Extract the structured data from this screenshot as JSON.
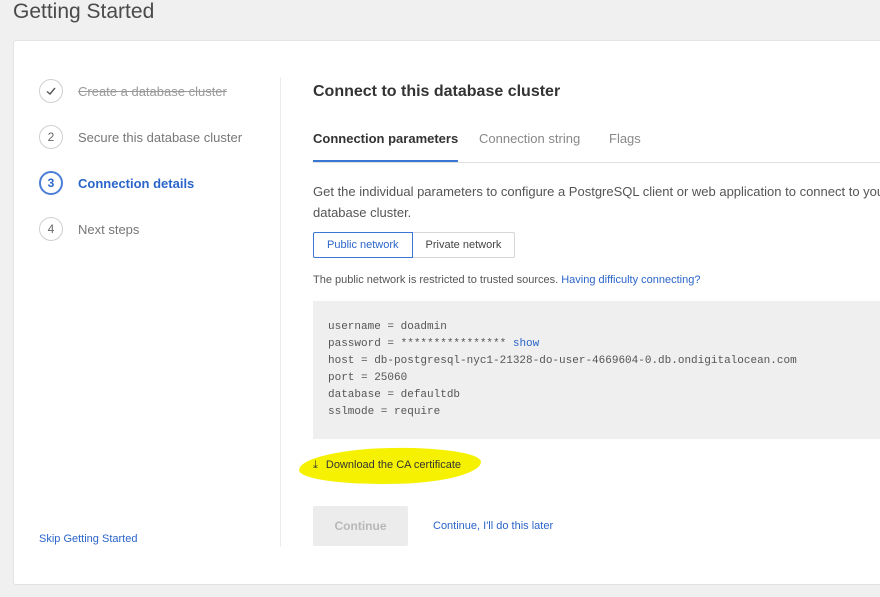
{
  "page_title": "Getting Started",
  "steps": [
    {
      "number": "",
      "label": "Create a database cluster",
      "state": "done"
    },
    {
      "number": "2",
      "label": "Secure this database cluster",
      "state": "todo"
    },
    {
      "number": "3",
      "label": "Connection details",
      "state": "active"
    },
    {
      "number": "4",
      "label": "Next steps",
      "state": "todo"
    }
  ],
  "skip_label": "Skip Getting Started",
  "main": {
    "title": "Connect to this database cluster",
    "tabs": [
      {
        "label": "Connection parameters",
        "active": true
      },
      {
        "label": "Connection string",
        "active": false
      },
      {
        "label": "Flags",
        "active": false
      }
    ],
    "description": "Get the individual parameters to configure a PostgreSQL client or web application to connect to your database cluster.",
    "network_options": {
      "public": "Public network",
      "private": "Private network",
      "selected": "Public network"
    },
    "note_text": "The public network is restricted to trusted sources.",
    "note_link": "Having difficulty connecting?",
    "params": {
      "username_line": "username = doadmin",
      "password_line": "password = ****************",
      "show_label": "show",
      "host_line": "host = db-postgresql-nyc1-21328-do-user-4669604-0.db.ondigitalocean.com",
      "port_line": "port = 25060",
      "database_line": "database = defaultdb",
      "sslmode_line": "sslmode = require"
    },
    "download_label": "Download the CA certificate",
    "continue_label": "Continue",
    "later_label": "Continue, I'll do this later"
  },
  "colors": {
    "accent": "#2a65c9",
    "highlight": "#f5f100",
    "code_bg": "#efefef"
  }
}
